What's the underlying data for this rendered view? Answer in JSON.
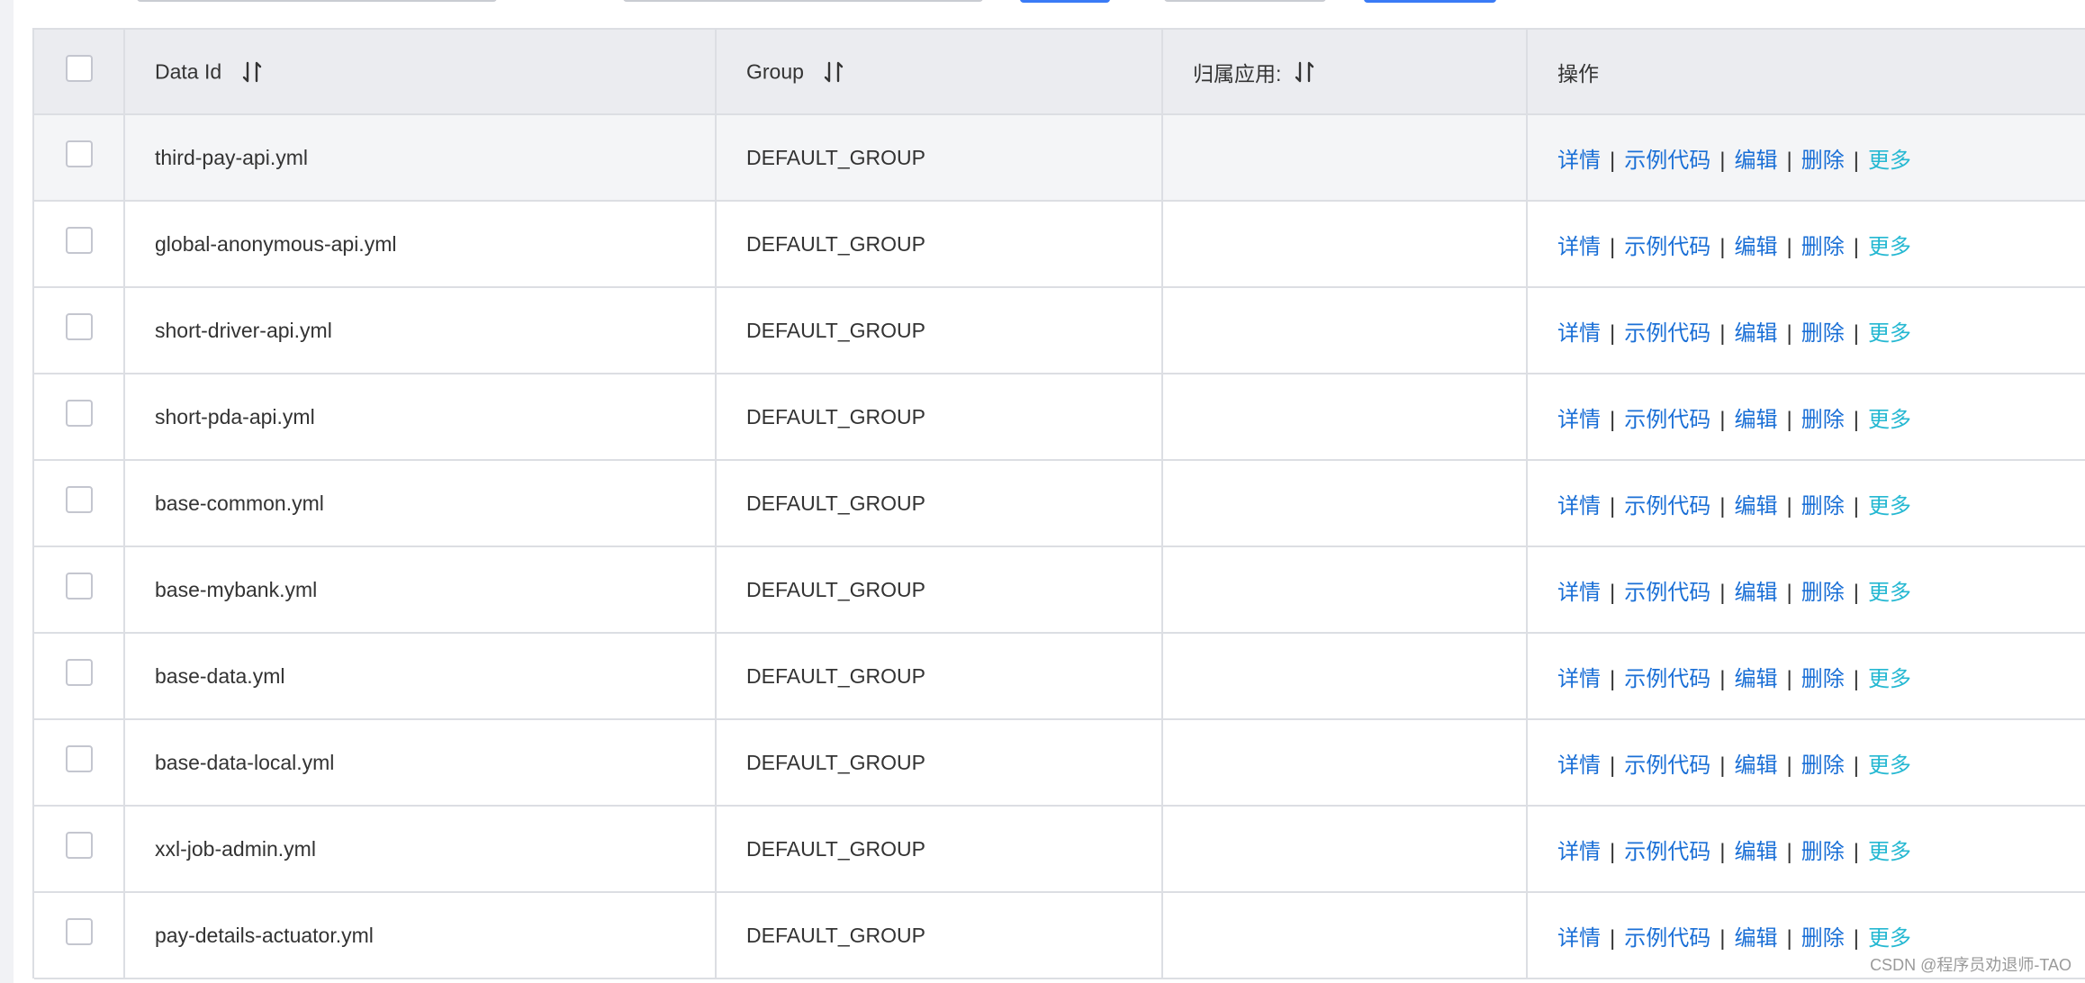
{
  "table": {
    "columns": {
      "data_id": "Data Id",
      "group": "Group",
      "app": "归属应用:",
      "ops": "操作"
    },
    "rows": [
      {
        "data_id": "third-pay-api.yml",
        "group": "DEFAULT_GROUP",
        "app": ""
      },
      {
        "data_id": "global-anonymous-api.yml",
        "group": "DEFAULT_GROUP",
        "app": ""
      },
      {
        "data_id": "short-driver-api.yml",
        "group": "DEFAULT_GROUP",
        "app": ""
      },
      {
        "data_id": "short-pda-api.yml",
        "group": "DEFAULT_GROUP",
        "app": ""
      },
      {
        "data_id": "base-common.yml",
        "group": "DEFAULT_GROUP",
        "app": ""
      },
      {
        "data_id": "base-mybank.yml",
        "group": "DEFAULT_GROUP",
        "app": ""
      },
      {
        "data_id": "base-data.yml",
        "group": "DEFAULT_GROUP",
        "app": ""
      },
      {
        "data_id": "base-data-local.yml",
        "group": "DEFAULT_GROUP",
        "app": ""
      },
      {
        "data_id": "xxl-job-admin.yml",
        "group": "DEFAULT_GROUP",
        "app": ""
      },
      {
        "data_id": "pay-details-actuator.yml",
        "group": "DEFAULT_GROUP",
        "app": ""
      }
    ],
    "actions": {
      "detail": "详情",
      "sample_code": "示例代码",
      "edit": "编辑",
      "delete": "删除",
      "more": "更多",
      "separator": "|"
    }
  },
  "watermark": "CSDN @程序员劝退师-TAO",
  "colors": {
    "link": "#1a6fd6",
    "more_link": "#25b8d2",
    "header_bg": "#ebecf0",
    "border": "#dcdee3",
    "primary_button": "#3a7bf6"
  }
}
